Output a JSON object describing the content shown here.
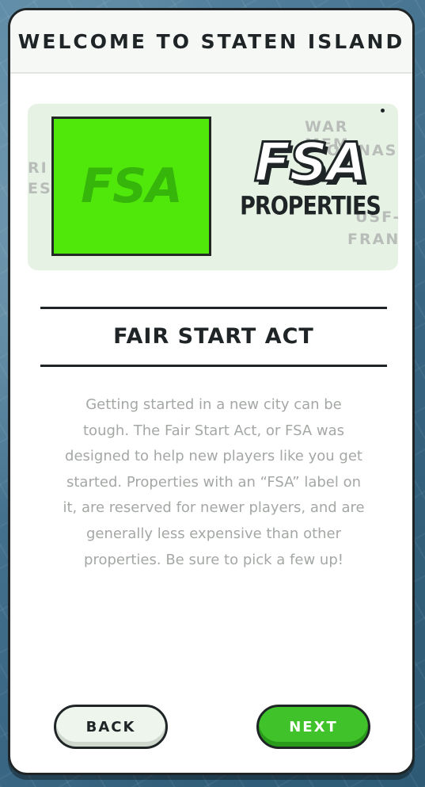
{
  "modal": {
    "title": "WELCOME TO STATEN ISLAND"
  },
  "hero": {
    "tile_text": "FSA",
    "logo_main": "FSA",
    "logo_sub": "PROPERTIES",
    "bg_labels": [
      "WAR MEM",
      "OMNAS",
      "RI",
      "ES",
      "USF-",
      "FRAN"
    ]
  },
  "section": {
    "title": "FAIR START ACT"
  },
  "body": {
    "text": "Getting started in a new city can be tough. The Fair Start Act, or FSA was designed to help new players like you get started. Properties with an “FSA” label on it, are reserved for newer players, and are generally less expensive than other properties. Be sure to pick a few up!"
  },
  "buttons": {
    "back": "BACK",
    "next": "NEXT"
  },
  "colors": {
    "fsa_green": "#4fe80a",
    "next_green": "#3fc22a",
    "ink": "#1f2526",
    "body_gray": "#a4a8a4"
  }
}
